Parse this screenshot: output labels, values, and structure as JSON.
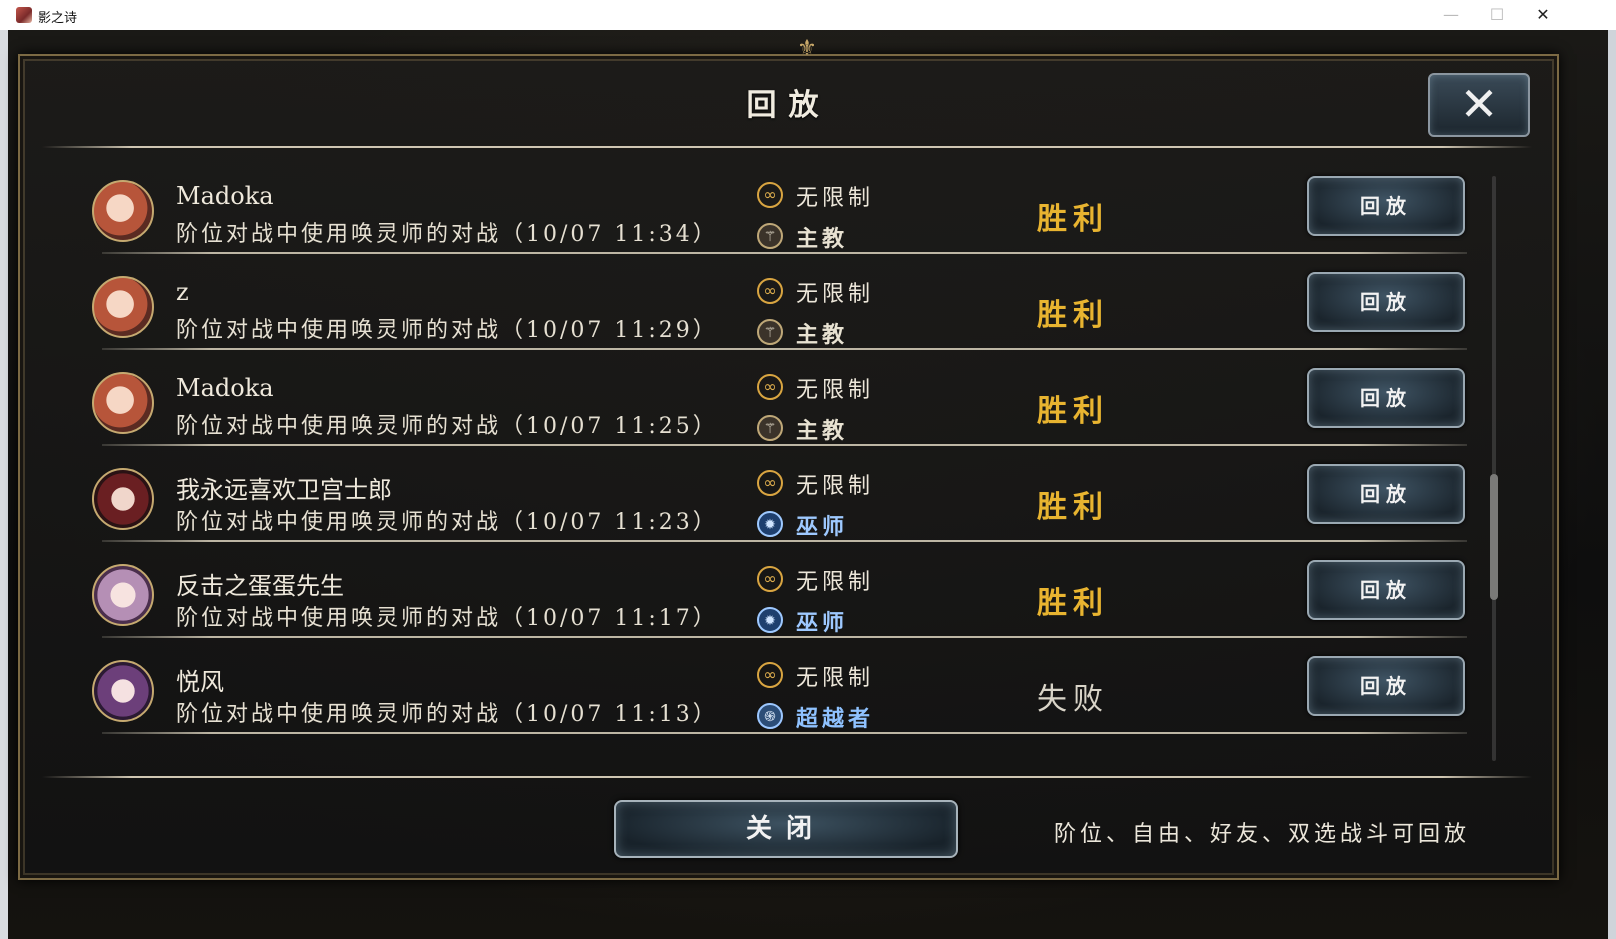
{
  "window": {
    "title": "影之诗",
    "minimize": "—",
    "maximize": "☐",
    "close": "✕"
  },
  "dialog": {
    "title": "回放",
    "close_icon": "close-x-icon",
    "close_button": "关闭",
    "footer_note": "阶位、自由、好友、双选战斗可回放"
  },
  "colors": {
    "victory": "#e8b430",
    "defeat": "#d9d4c8",
    "bishop": "#e8e2d2",
    "runecraft": "#9ec9ff",
    "havencraft": "#8fc2ff"
  },
  "replays": [
    {
      "opponent": "Madoka",
      "description": "阶位对战中使用唤灵师的对战（10/07 11:34）",
      "format": "无限制",
      "opponent_class": "主教",
      "class_icon": "bishop-icon",
      "result": "胜利",
      "button": "回放"
    },
    {
      "opponent": "z",
      "description": "阶位对战中使用唤灵师的对战（10/07 11:29）",
      "format": "无限制",
      "opponent_class": "主教",
      "class_icon": "bishop-icon",
      "result": "胜利",
      "button": "回放"
    },
    {
      "opponent": "Madoka",
      "description": "阶位对战中使用唤灵师的对战（10/07 11:25）",
      "format": "无限制",
      "opponent_class": "主教",
      "class_icon": "bishop-icon",
      "result": "胜利",
      "button": "回放"
    },
    {
      "opponent": "我永远喜欢卫宫士郎",
      "description": "阶位对战中使用唤灵师的对战（10/07 11:23）",
      "format": "无限制",
      "opponent_class": "巫师",
      "class_icon": "runecraft-icon",
      "result": "胜利",
      "button": "回放"
    },
    {
      "opponent": "反击之蛋蛋先生",
      "description": "阶位对战中使用唤灵师的对战（10/07 11:17）",
      "format": "无限制",
      "opponent_class": "巫师",
      "class_icon": "runecraft-icon",
      "result": "胜利",
      "button": "回放"
    },
    {
      "opponent": "悦风",
      "description": "阶位对战中使用唤灵师的对战（10/07 11:13）",
      "format": "无限制",
      "opponent_class": "超越者",
      "class_icon": "portalcraft-icon",
      "result": "失败",
      "button": "回放"
    }
  ]
}
